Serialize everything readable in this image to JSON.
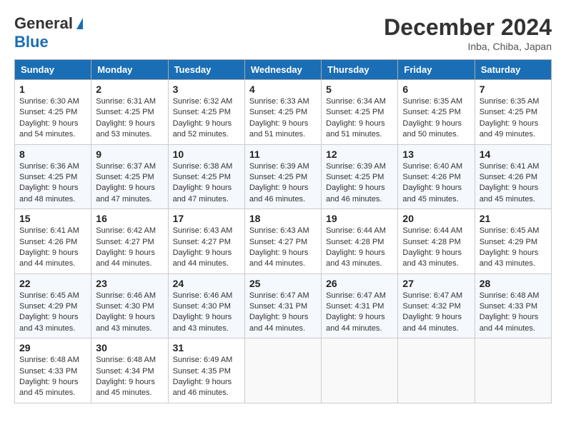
{
  "header": {
    "logo_general": "General",
    "logo_blue": "Blue",
    "month": "December 2024",
    "location": "Inba, Chiba, Japan"
  },
  "weekdays": [
    "Sunday",
    "Monday",
    "Tuesday",
    "Wednesday",
    "Thursday",
    "Friday",
    "Saturday"
  ],
  "weeks": [
    [
      {
        "day": "1",
        "sunrise": "6:30 AM",
        "sunset": "4:25 PM",
        "daylight_hours": "9",
        "daylight_minutes": "54"
      },
      {
        "day": "2",
        "sunrise": "6:31 AM",
        "sunset": "4:25 PM",
        "daylight_hours": "9",
        "daylight_minutes": "53"
      },
      {
        "day": "3",
        "sunrise": "6:32 AM",
        "sunset": "4:25 PM",
        "daylight_hours": "9",
        "daylight_minutes": "52"
      },
      {
        "day": "4",
        "sunrise": "6:33 AM",
        "sunset": "4:25 PM",
        "daylight_hours": "9",
        "daylight_minutes": "51"
      },
      {
        "day": "5",
        "sunrise": "6:34 AM",
        "sunset": "4:25 PM",
        "daylight_hours": "9",
        "daylight_minutes": "51"
      },
      {
        "day": "6",
        "sunrise": "6:35 AM",
        "sunset": "4:25 PM",
        "daylight_hours": "9",
        "daylight_minutes": "50"
      },
      {
        "day": "7",
        "sunrise": "6:35 AM",
        "sunset": "4:25 PM",
        "daylight_hours": "9",
        "daylight_minutes": "49"
      }
    ],
    [
      {
        "day": "8",
        "sunrise": "6:36 AM",
        "sunset": "4:25 PM",
        "daylight_hours": "9",
        "daylight_minutes": "48"
      },
      {
        "day": "9",
        "sunrise": "6:37 AM",
        "sunset": "4:25 PM",
        "daylight_hours": "9",
        "daylight_minutes": "47"
      },
      {
        "day": "10",
        "sunrise": "6:38 AM",
        "sunset": "4:25 PM",
        "daylight_hours": "9",
        "daylight_minutes": "47"
      },
      {
        "day": "11",
        "sunrise": "6:39 AM",
        "sunset": "4:25 PM",
        "daylight_hours": "9",
        "daylight_minutes": "46"
      },
      {
        "day": "12",
        "sunrise": "6:39 AM",
        "sunset": "4:25 PM",
        "daylight_hours": "9",
        "daylight_minutes": "46"
      },
      {
        "day": "13",
        "sunrise": "6:40 AM",
        "sunset": "4:26 PM",
        "daylight_hours": "9",
        "daylight_minutes": "45"
      },
      {
        "day": "14",
        "sunrise": "6:41 AM",
        "sunset": "4:26 PM",
        "daylight_hours": "9",
        "daylight_minutes": "45"
      }
    ],
    [
      {
        "day": "15",
        "sunrise": "6:41 AM",
        "sunset": "4:26 PM",
        "daylight_hours": "9",
        "daylight_minutes": "44"
      },
      {
        "day": "16",
        "sunrise": "6:42 AM",
        "sunset": "4:27 PM",
        "daylight_hours": "9",
        "daylight_minutes": "44"
      },
      {
        "day": "17",
        "sunrise": "6:43 AM",
        "sunset": "4:27 PM",
        "daylight_hours": "9",
        "daylight_minutes": "44"
      },
      {
        "day": "18",
        "sunrise": "6:43 AM",
        "sunset": "4:27 PM",
        "daylight_hours": "9",
        "daylight_minutes": "44"
      },
      {
        "day": "19",
        "sunrise": "6:44 AM",
        "sunset": "4:28 PM",
        "daylight_hours": "9",
        "daylight_minutes": "43"
      },
      {
        "day": "20",
        "sunrise": "6:44 AM",
        "sunset": "4:28 PM",
        "daylight_hours": "9",
        "daylight_minutes": "43"
      },
      {
        "day": "21",
        "sunrise": "6:45 AM",
        "sunset": "4:29 PM",
        "daylight_hours": "9",
        "daylight_minutes": "43"
      }
    ],
    [
      {
        "day": "22",
        "sunrise": "6:45 AM",
        "sunset": "4:29 PM",
        "daylight_hours": "9",
        "daylight_minutes": "43"
      },
      {
        "day": "23",
        "sunrise": "6:46 AM",
        "sunset": "4:30 PM",
        "daylight_hours": "9",
        "daylight_minutes": "43"
      },
      {
        "day": "24",
        "sunrise": "6:46 AM",
        "sunset": "4:30 PM",
        "daylight_hours": "9",
        "daylight_minutes": "43"
      },
      {
        "day": "25",
        "sunrise": "6:47 AM",
        "sunset": "4:31 PM",
        "daylight_hours": "9",
        "daylight_minutes": "44"
      },
      {
        "day": "26",
        "sunrise": "6:47 AM",
        "sunset": "4:31 PM",
        "daylight_hours": "9",
        "daylight_minutes": "44"
      },
      {
        "day": "27",
        "sunrise": "6:47 AM",
        "sunset": "4:32 PM",
        "daylight_hours": "9",
        "daylight_minutes": "44"
      },
      {
        "day": "28",
        "sunrise": "6:48 AM",
        "sunset": "4:33 PM",
        "daylight_hours": "9",
        "daylight_minutes": "44"
      }
    ],
    [
      {
        "day": "29",
        "sunrise": "6:48 AM",
        "sunset": "4:33 PM",
        "daylight_hours": "9",
        "daylight_minutes": "45"
      },
      {
        "day": "30",
        "sunrise": "6:48 AM",
        "sunset": "4:34 PM",
        "daylight_hours": "9",
        "daylight_minutes": "45"
      },
      {
        "day": "31",
        "sunrise": "6:49 AM",
        "sunset": "4:35 PM",
        "daylight_hours": "9",
        "daylight_minutes": "46"
      },
      null,
      null,
      null,
      null
    ]
  ],
  "labels": {
    "sunrise": "Sunrise:",
    "sunset": "Sunset:",
    "daylight": "Daylight:"
  }
}
